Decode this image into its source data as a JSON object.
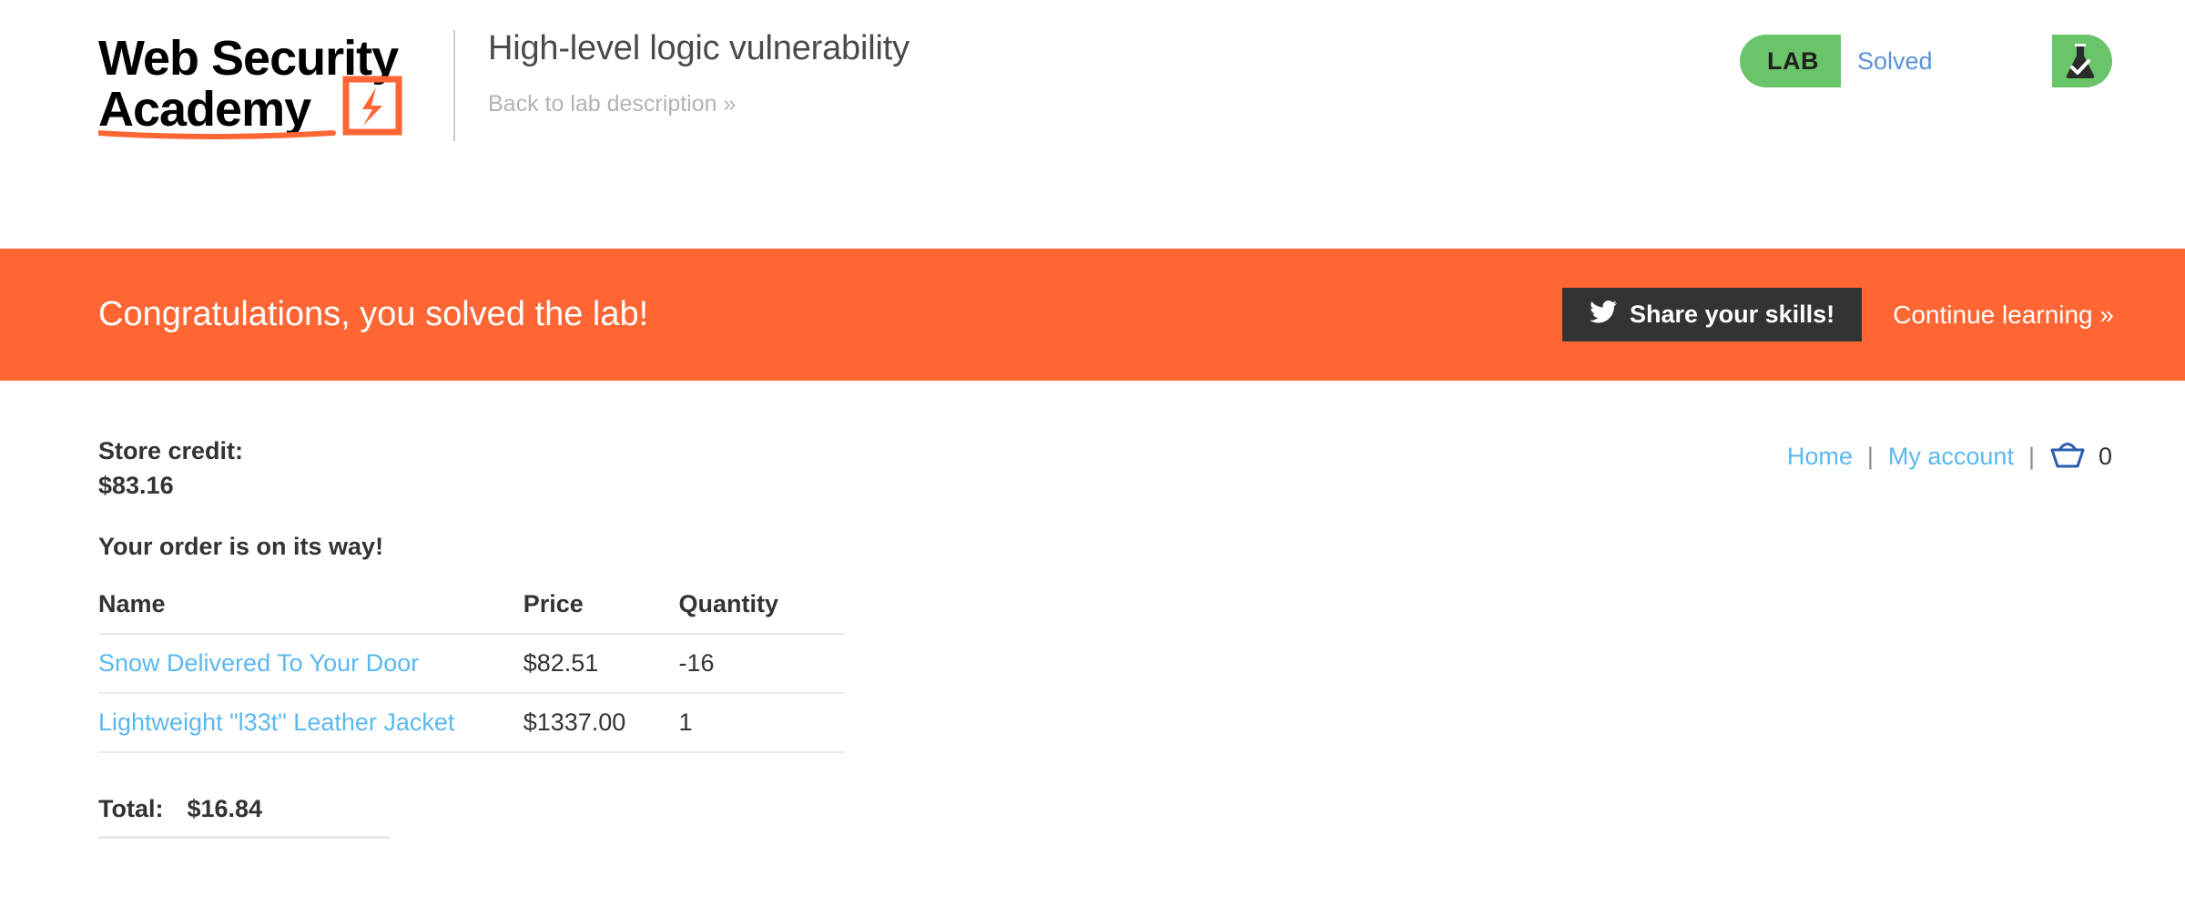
{
  "header": {
    "logo": {
      "line1": "Web Security",
      "line2": "Academy",
      "icon": "lightning-bolt-logo-mark"
    },
    "lab_title": "High-level logic vulnerability",
    "back_link": "Back to lab description",
    "back_link_chevron": "»",
    "lab_status": {
      "tag": "LAB",
      "state": "Solved",
      "icon": "flask-check-icon",
      "green": "#6ac46a"
    }
  },
  "banner": {
    "message": "Congratulations, you solved the lab!",
    "share_label": "Share your skills!",
    "share_icon": "twitter-bird-icon",
    "continue_label": "Continue learning",
    "continue_chevron": "»",
    "background": "#ff6633"
  },
  "store": {
    "credit_label": "Store credit:",
    "credit_value": "$83.16",
    "order_status": "Your order is on its way!",
    "table": {
      "columns": [
        "Name",
        "Price",
        "Quantity"
      ],
      "rows": [
        {
          "name": "Snow Delivered To Your Door",
          "price": "$82.51",
          "quantity": "-16"
        },
        {
          "name": "Lightweight \"l33t\" Leather Jacket",
          "price": "$1337.00",
          "quantity": "1"
        }
      ]
    },
    "total_label": "Total:",
    "total_value": "$16.84"
  },
  "nav": {
    "home": "Home",
    "separator": "|",
    "my_account": "My account",
    "basket_icon": "basket-icon",
    "basket_count": "0"
  }
}
